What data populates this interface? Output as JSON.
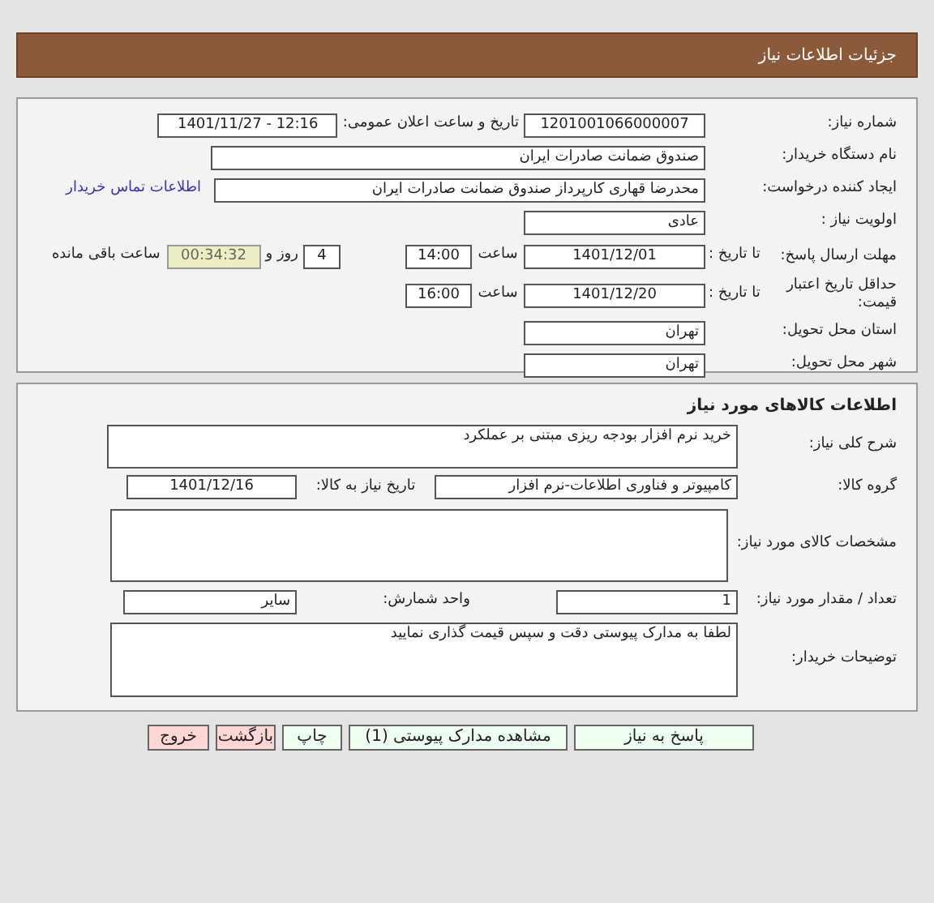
{
  "header": {
    "title": "جزئیات اطلاعات نیاز"
  },
  "general": {
    "need_number": {
      "label": "شماره نیاز:",
      "value": "1201001066000007"
    },
    "announce": {
      "label": "تاریخ و ساعت اعلان عمومی:",
      "value": "1401/11/27 - 12:16"
    },
    "buyer": {
      "label": "نام دستگاه خریدار:",
      "value": "صندوق ضمانت صادرات ایران"
    },
    "creator": {
      "label": "ایجاد کننده درخواست:",
      "value": "محدرضا قهاری کارپرداز صندوق ضمانت صادرات ایران",
      "link": "اطلاعات تماس خریدار"
    },
    "priority": {
      "label": "اولویت نیاز :",
      "value": "عادی"
    },
    "deadline": {
      "label": "مهلت ارسال پاسخ:",
      "until": "تا تاریخ :",
      "date": "1401/12/01",
      "time_label": "ساعت",
      "time": "14:00",
      "days": "4",
      "days_label": "روز و",
      "remaining": "00:34:32",
      "remaining_label": "ساعت باقی مانده"
    },
    "validity": {
      "label": "حداقل تاریخ اعتبار قیمت:",
      "until": "تا تاریخ :",
      "date": "1401/12/20",
      "time_label": "ساعت",
      "time": "16:00"
    },
    "province": {
      "label": "استان محل تحویل:",
      "value": "تهران"
    },
    "city": {
      "label": "شهر محل تحویل:",
      "value": "تهران"
    }
  },
  "goods": {
    "title": "اطلاعات کالاهای مورد نیاز",
    "description": {
      "label": "شرح کلی نیاز:",
      "value": "خرید نرم افزار بودجه ریزی مبتنی بر عملکرد"
    },
    "group": {
      "label": "گروه کالا:",
      "value": "کامپیوتر و فناوری اطلاعات-نرم افزار",
      "date_label": "تاریخ نیاز به کالا:",
      "date": "1401/12/16"
    },
    "specs": {
      "label": "مشخصات کالای مورد نیاز:"
    },
    "quantity": {
      "label": "تعداد / مقدار مورد نیاز:",
      "value": "1",
      "unit_label": "واحد شمارش:",
      "unit": "سایر"
    },
    "notes": {
      "label": "توضیحات خریدار:",
      "value": "لطفا به مدارک پیوستی دقت و سپس قیمت گذاری نمایید"
    }
  },
  "buttons": [
    {
      "label": "پاسخ به نیاز",
      "kind": "primary"
    },
    {
      "label": "مشاهده مدارک پیوستی (1)",
      "kind": "primary"
    },
    {
      "label": "چاپ",
      "kind": "primary"
    },
    {
      "label": "بازگشت",
      "kind": "danger"
    },
    {
      "label": "خروج",
      "kind": "danger"
    }
  ]
}
